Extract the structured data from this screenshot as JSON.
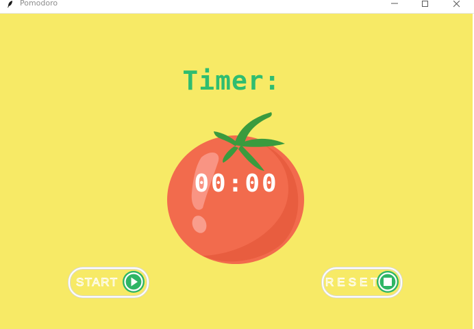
{
  "window": {
    "title": "Pomodoro"
  },
  "titlebar": {
    "minimize_label": "–",
    "maximize_label": "☐",
    "close_label": "✕"
  },
  "main": {
    "timer_label": "Timer:",
    "time_display": "00:00",
    "start_label": "START",
    "reset_label": "RESET"
  },
  "icons": {
    "app": "feather-icon",
    "tomato": "tomato-image",
    "start": "play-icon",
    "reset": "stop-icon"
  },
  "colors": {
    "background": "#f7ea66",
    "timer_label": "#2fbd70",
    "tomato": "#f26b4d",
    "leaf": "#3a9b3e",
    "button_icon": "#2fb565"
  }
}
